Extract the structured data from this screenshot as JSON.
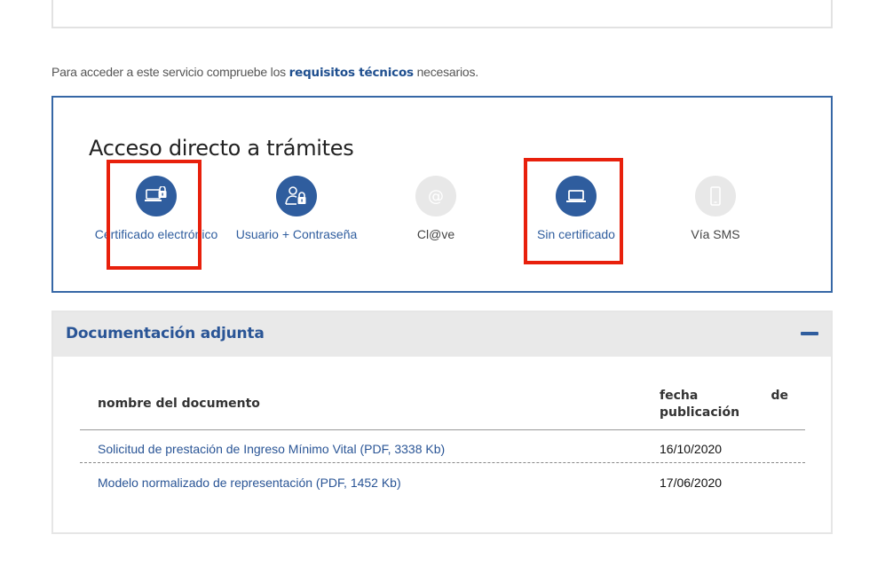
{
  "requirements": {
    "prefix": "Para acceder a este servicio compruebe los ",
    "link": "requisitos técnicos",
    "suffix": " necesarios."
  },
  "access": {
    "title": "Acceso directo a trámites",
    "options": [
      {
        "label": "Certificado electrónico",
        "icon": "laptop-lock-icon",
        "state": "active",
        "highlighted": true
      },
      {
        "label": "Usuario + Contraseña",
        "icon": "user-lock-icon",
        "state": "active",
        "highlighted": false
      },
      {
        "label": "Cl@ve",
        "icon": "at-sign-icon",
        "state": "disabled",
        "highlighted": false
      },
      {
        "label": "Sin certificado",
        "icon": "laptop-icon",
        "state": "active",
        "highlighted": true
      },
      {
        "label": "Vía SMS",
        "icon": "mobile-phone-icon",
        "state": "disabled",
        "highlighted": false
      }
    ]
  },
  "documents": {
    "title": "Documentación adjunta",
    "columns": {
      "name": "nombre del documento",
      "date": "fecha de publicación"
    },
    "rows": [
      {
        "name": "Solicitud de prestación de Ingreso Mínimo Vital (PDF, 3338 Kb)",
        "date": "16/10/2020"
      },
      {
        "name": "Modelo normalizado de representación (PDF, 1452 Kb)",
        "date": "17/06/2020"
      }
    ]
  },
  "colors": {
    "accent": "#2f5d9e",
    "highlight": "#e8200c",
    "disabled": "#e8e8e8"
  }
}
